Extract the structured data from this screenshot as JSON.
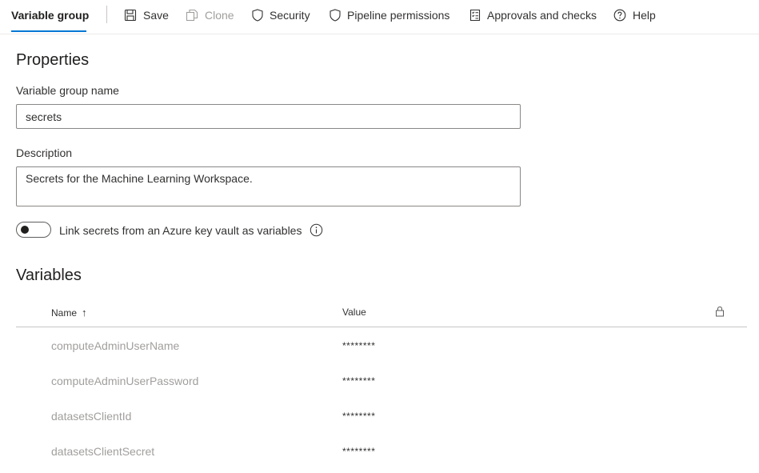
{
  "toolbar": {
    "active_tab": "Variable group",
    "buttons": [
      {
        "label": "Save",
        "icon": "save-icon",
        "disabled": false
      },
      {
        "label": "Clone",
        "icon": "clone-icon",
        "disabled": true
      },
      {
        "label": "Security",
        "icon": "shield-icon",
        "disabled": false
      },
      {
        "label": "Pipeline permissions",
        "icon": "shield-icon",
        "disabled": false
      },
      {
        "label": "Approvals and checks",
        "icon": "checklist-icon",
        "disabled": false
      },
      {
        "label": "Help",
        "icon": "help-icon",
        "disabled": false
      }
    ]
  },
  "properties": {
    "title": "Properties",
    "name_label": "Variable group name",
    "name_value": "secrets",
    "description_label": "Description",
    "description_value": "Secrets for the Machine Learning Workspace.",
    "keyvault_toggle_label": "Link secrets from an Azure key vault as variables",
    "keyvault_toggle_on": false
  },
  "variables": {
    "title": "Variables",
    "columns": {
      "name": "Name",
      "name_sort": "↑",
      "value": "Value",
      "lock_icon": "lock-icon"
    },
    "rows": [
      {
        "name": "computeAdminUserName",
        "value": "********"
      },
      {
        "name": "computeAdminUserPassword",
        "value": "********"
      },
      {
        "name": "datasetsClientId",
        "value": "********"
      },
      {
        "name": "datasetsClientSecret",
        "value": "********"
      }
    ]
  },
  "colors": {
    "accent": "#0078d4",
    "text": "#323130",
    "muted": "#a19f9d"
  }
}
